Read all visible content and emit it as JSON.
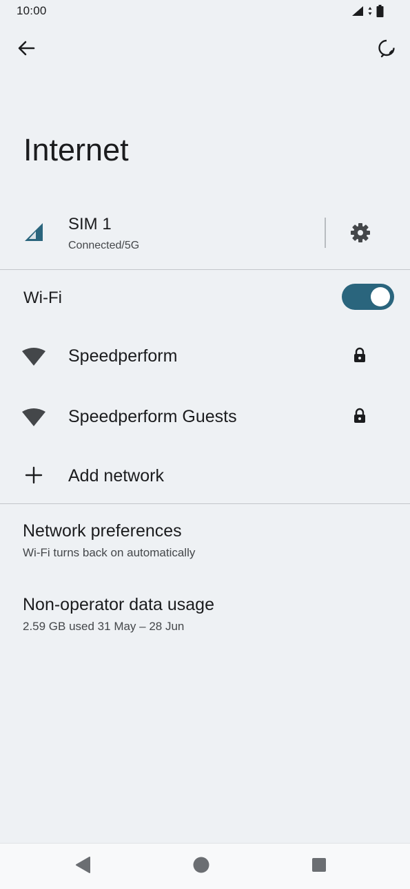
{
  "status_bar": {
    "time": "10:00",
    "icons": [
      "signal-icon",
      "data-arrows-icon",
      "battery-icon"
    ]
  },
  "toolbar": {
    "back_icon": "arrow-back-icon",
    "help_icon": "help-feedback-icon"
  },
  "page": {
    "title": "Internet"
  },
  "sim": {
    "name": "SIM 1",
    "status": "Connected/5G",
    "signal_icon": "cell-signal-icon",
    "settings_icon": "gear-icon"
  },
  "wifi": {
    "label": "Wi-Fi",
    "enabled": true,
    "accent_color": "#2a657d",
    "networks": [
      {
        "name": "Speedperform",
        "secured": true
      },
      {
        "name": "Speedperform Guests",
        "secured": true
      }
    ],
    "add_network_label": "Add network"
  },
  "preferences": [
    {
      "title": "Network preferences",
      "subtitle": "Wi-Fi turns back on automatically"
    },
    {
      "title": "Non-operator data usage",
      "subtitle": "2.59 GB used 31 May – 28 Jun"
    }
  ],
  "nav_bar": {
    "buttons": [
      "back-triangle-icon",
      "home-circle-icon",
      "recents-square-icon"
    ]
  }
}
